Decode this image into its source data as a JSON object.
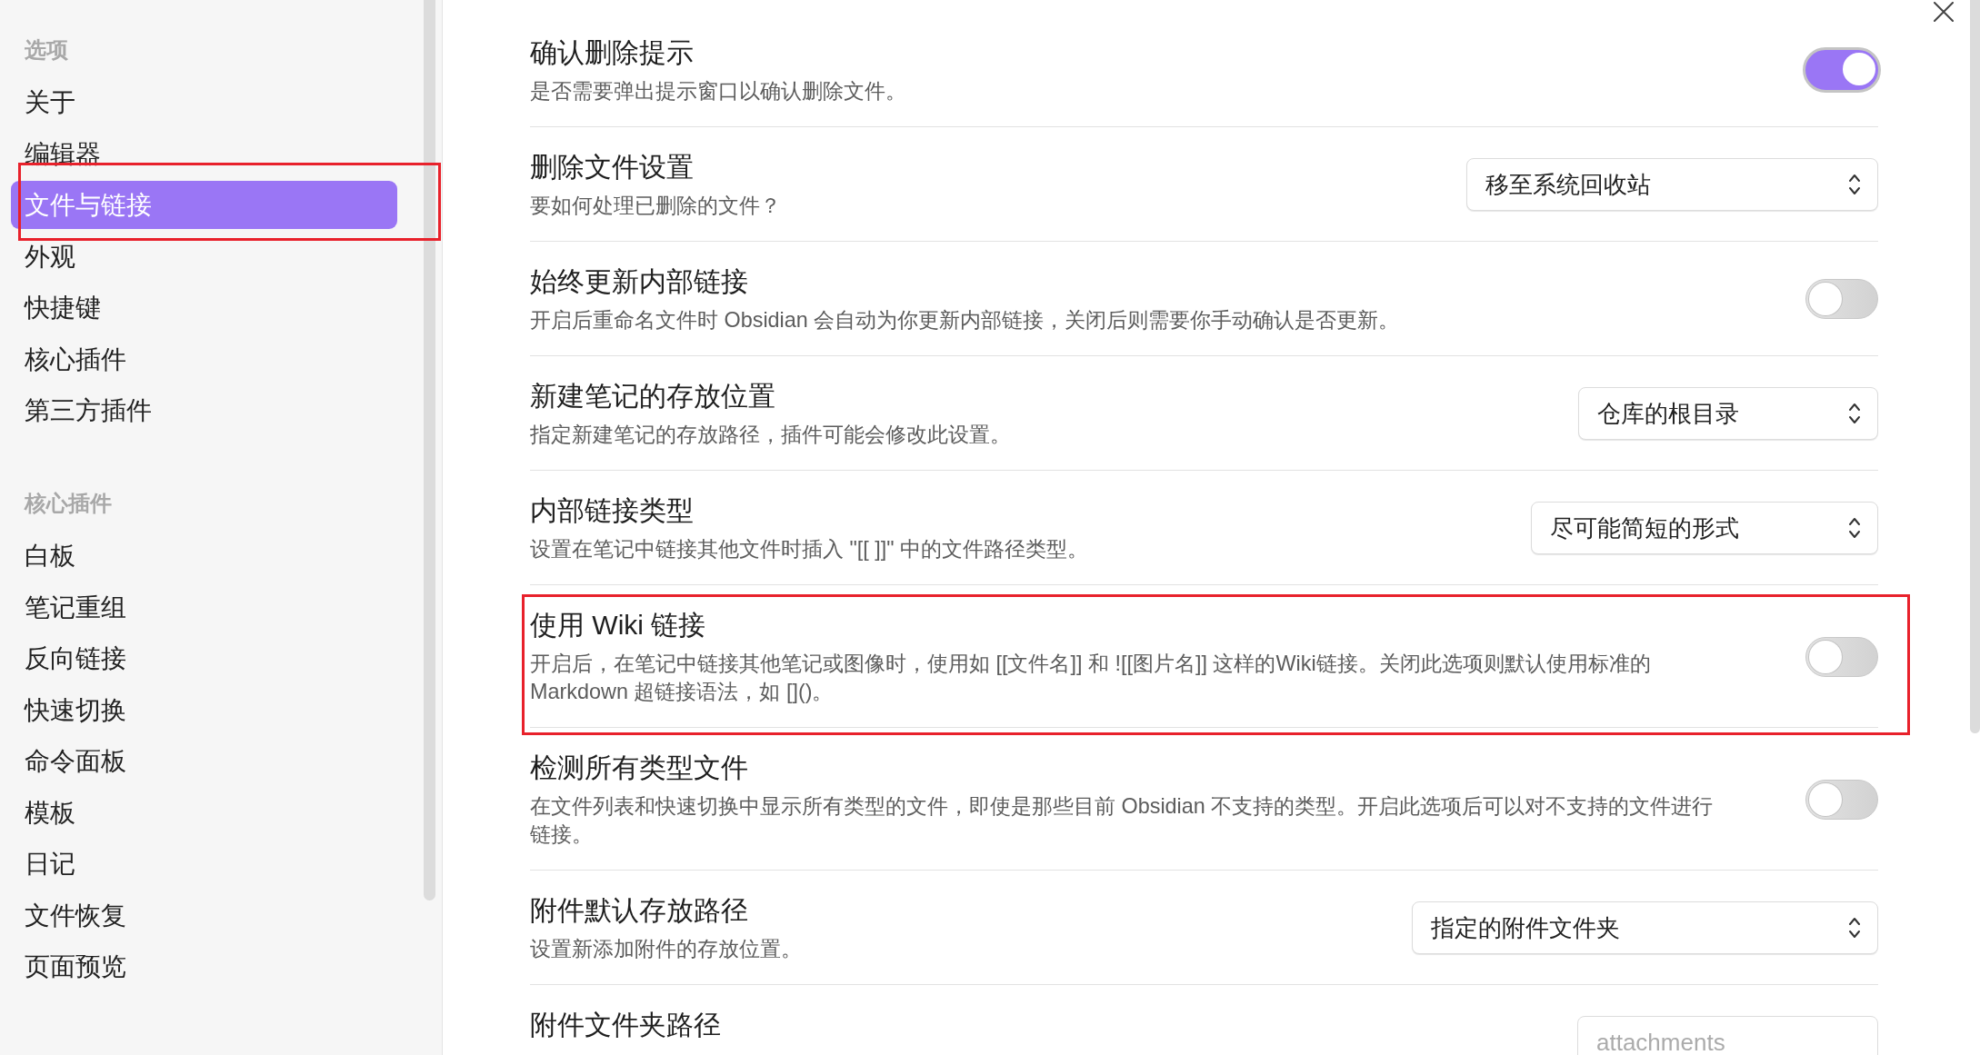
{
  "sidebar": {
    "sections": [
      {
        "title": "选项",
        "items": [
          {
            "label": "关于",
            "selected": false,
            "highlighted": false
          },
          {
            "label": "编辑器",
            "selected": false,
            "highlighted": false
          },
          {
            "label": "文件与链接",
            "selected": true,
            "highlighted": true
          },
          {
            "label": "外观",
            "selected": false,
            "highlighted": false
          },
          {
            "label": "快捷键",
            "selected": false,
            "highlighted": false
          },
          {
            "label": "核心插件",
            "selected": false,
            "highlighted": false
          },
          {
            "label": "第三方插件",
            "selected": false,
            "highlighted": false
          }
        ]
      },
      {
        "title": "核心插件",
        "items": [
          {
            "label": "白板",
            "selected": false,
            "highlighted": false
          },
          {
            "label": "笔记重组",
            "selected": false,
            "highlighted": false
          },
          {
            "label": "反向链接",
            "selected": false,
            "highlighted": false
          },
          {
            "label": "快速切换",
            "selected": false,
            "highlighted": false
          },
          {
            "label": "命令面板",
            "selected": false,
            "highlighted": false
          },
          {
            "label": "模板",
            "selected": false,
            "highlighted": false
          },
          {
            "label": "日记",
            "selected": false,
            "highlighted": false
          },
          {
            "label": "文件恢复",
            "selected": false,
            "highlighted": false
          },
          {
            "label": "页面预览",
            "selected": false,
            "highlighted": false
          }
        ]
      }
    ]
  },
  "settings": [
    {
      "kind": "toggle",
      "title": "确认删除提示",
      "description": "是否需要弹出提示窗口以确认删除文件。",
      "on": true,
      "focused": true,
      "highlighted": false
    },
    {
      "kind": "select",
      "title": "删除文件设置",
      "description": "要如何处理已删除的文件？",
      "value": "移至系统回收站",
      "highlighted": false
    },
    {
      "kind": "toggle",
      "title": "始终更新内部链接",
      "description": "开启后重命名文件时 Obsidian 会自动为你更新内部链接，关闭后则需要你手动确认是否更新。",
      "on": false,
      "focused": false,
      "highlighted": false
    },
    {
      "kind": "select",
      "title": "新建笔记的存放位置",
      "description": "指定新建笔记的存放路径，插件可能会修改此设置。",
      "value": "仓库的根目录",
      "highlighted": false
    },
    {
      "kind": "select",
      "title": "内部链接类型",
      "description": "设置在笔记中链接其他文件时插入 \"[[ ]]\" 中的文件路径类型。",
      "value": "尽可能简短的形式",
      "highlighted": false
    },
    {
      "kind": "toggle",
      "title": "使用 Wiki 链接",
      "description": "开启后，在笔记中链接其他笔记或图像时，使用如 [[文件名]] 和 ![[图片名]] 这样的Wiki链接。关闭此选项则默认使用标准的 Markdown 超链接语法，如 []()。",
      "on": false,
      "focused": false,
      "highlighted": true
    },
    {
      "kind": "toggle",
      "title": "检测所有类型文件",
      "description": "在文件列表和快速切换中显示所有类型的文件，即使是那些目前 Obsidian 不支持的类型。开启此选项后可以对不支持的文件进行链接。",
      "on": false,
      "focused": false,
      "highlighted": false
    },
    {
      "kind": "select",
      "title": "附件默认存放路径",
      "description": "设置新添加附件的存放位置。",
      "value": "指定的附件文件夹",
      "highlighted": false
    },
    {
      "kind": "text",
      "title": "附件文件夹路径",
      "placeholder": "attachments",
      "highlighted": false
    }
  ]
}
